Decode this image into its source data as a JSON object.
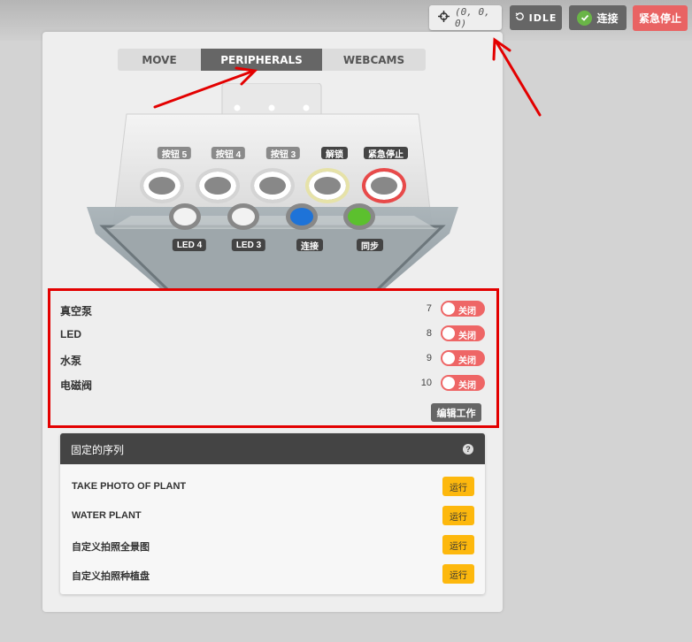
{
  "topbar": {
    "coordinates": "(0, 0, 0)",
    "status_label": "IDLE",
    "connect_label": "连接",
    "estop_label": "紧急停止"
  },
  "tabs": [
    {
      "label": "MOVE",
      "active": false
    },
    {
      "label": "PERIPHERALS",
      "active": true
    },
    {
      "label": "WEBCAMS",
      "active": false
    }
  ],
  "device": {
    "buttons_top": [
      {
        "label": "按钮 5",
        "ring": "#cccccc"
      },
      {
        "label": "按钮 4",
        "ring": "#cccccc"
      },
      {
        "label": "按钮 3",
        "ring": "#cccccc"
      },
      {
        "label": "解锁",
        "ring": "#e6e2a8"
      },
      {
        "label": "紧急停止",
        "ring": "#e84a4a"
      }
    ],
    "buttons_bottom": [
      {
        "label": "LED 4",
        "fill": "#f2f2f2"
      },
      {
        "label": "LED 3",
        "fill": "#f2f2f2"
      },
      {
        "label": "连接",
        "fill": "#1e73d8"
      },
      {
        "label": "同步",
        "fill": "#5cc02e"
      }
    ]
  },
  "peripherals": {
    "items": [
      {
        "name": "真空泵",
        "pin": "7",
        "state": "关闭"
      },
      {
        "name": "LED",
        "pin": "8",
        "state": "关闭"
      },
      {
        "name": "水泵",
        "pin": "9",
        "state": "关闭"
      },
      {
        "name": "电磁阀",
        "pin": "10",
        "state": "关闭"
      }
    ],
    "edit_label": "编辑工作"
  },
  "pinned": {
    "title": "固定的序列",
    "help_icon": "?",
    "items": [
      {
        "name": "TAKE PHOTO OF PLANT",
        "run_label": "运行"
      },
      {
        "name": "WATER PLANT",
        "run_label": "运行"
      },
      {
        "name": "自定义拍照全景图",
        "run_label": "运行"
      },
      {
        "name": "自定义拍照种植盘",
        "run_label": "运行"
      }
    ]
  },
  "colors": {
    "accent_red": "#e30000",
    "run_yellow": "#fdb80d",
    "toggle_off": "#ee6666",
    "connected_green": "#6ab547"
  }
}
